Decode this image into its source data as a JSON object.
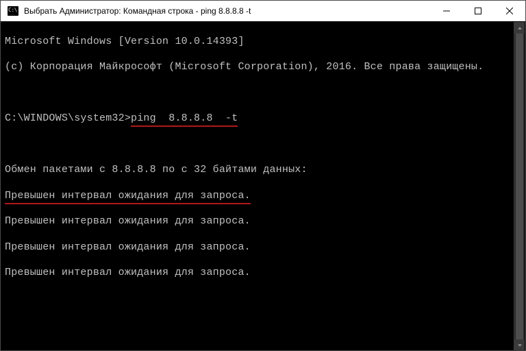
{
  "titlebar": {
    "select_prefix": "Выбрать",
    "title": "Администратор: Командная строка - ping  8.8.8.8 -t"
  },
  "terminal": {
    "banner_version": "Microsoft Windows [Version 10.0.14393]",
    "banner_copyright": "(c) Корпорация Майкрософт (Microsoft Corporation), 2016. Все права защищены.",
    "prompt_path": "C:\\WINDOWS\\system32>",
    "command": "ping  8.8.8.8  -t",
    "exchange_header": "Обмен пакетами с 8.8.8.8 по с 32 байтами данных:",
    "timeout_line": "Превышен интервал ожидания для запроса.",
    "timeout_repeat_count": 4,
    "underline_color": "#b01818"
  }
}
